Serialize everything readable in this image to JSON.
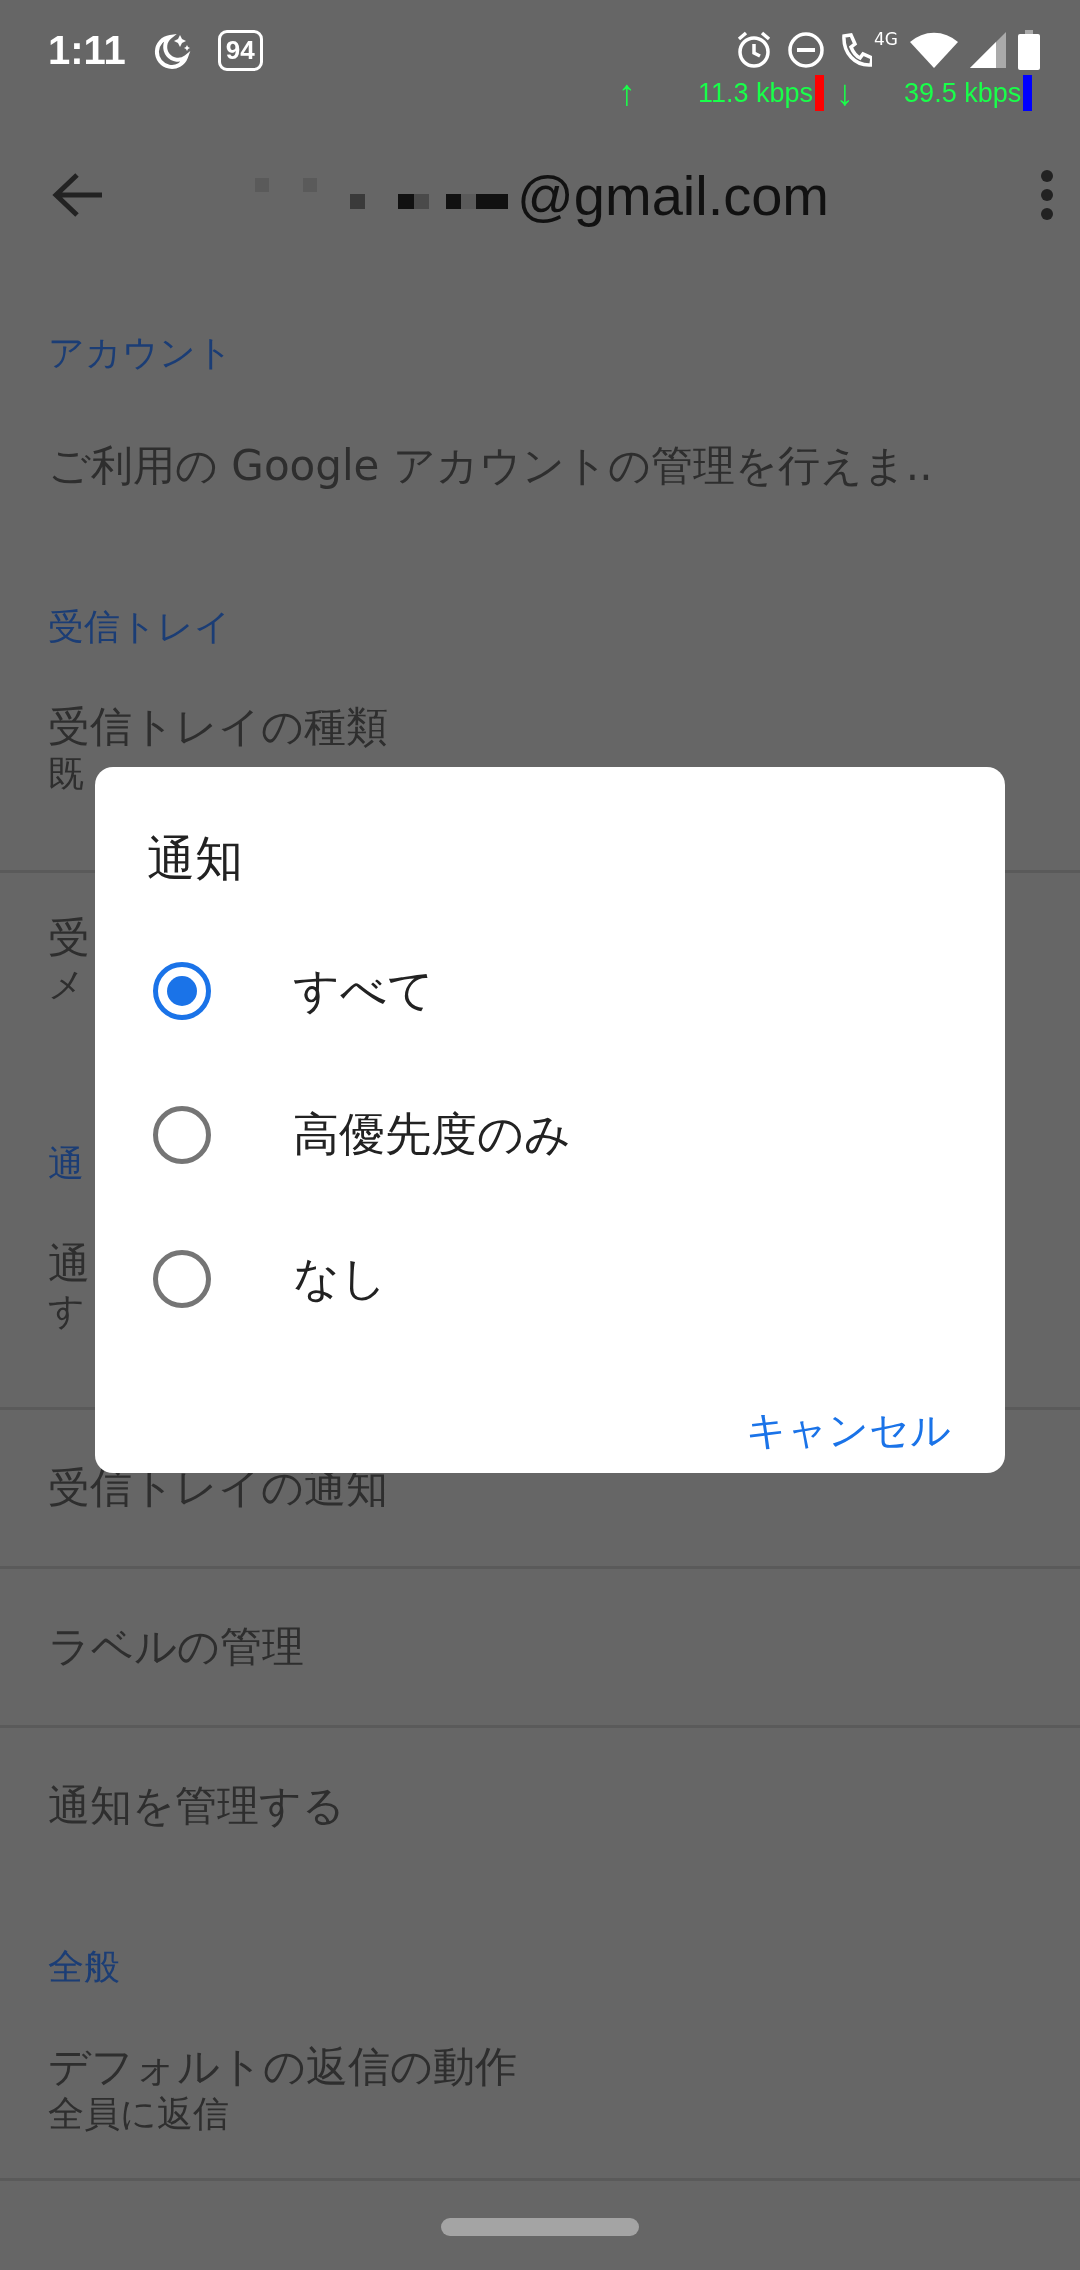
{
  "status_bar": {
    "time": "1:11",
    "battery_badge": "94",
    "network_type": "4G",
    "upload_arrow": "↑",
    "upload_speed": "11.3 kbps",
    "download_arrow": "↓",
    "download_speed": "39.5 kbps"
  },
  "app_bar": {
    "account": "@gmail.com"
  },
  "settings": [
    {
      "kind": "section",
      "label": "アカウント"
    },
    {
      "kind": "item",
      "title": "ご利用の Google アカウントの管理を行えま.."
    },
    {
      "kind": "section",
      "label": "受信トレイ"
    },
    {
      "kind": "item",
      "title": "受信トレイの種類",
      "subtitle": "既"
    },
    {
      "kind": "divider"
    },
    {
      "kind": "item",
      "title": "受",
      "subtitle": "メ"
    },
    {
      "kind": "section",
      "label": "通"
    },
    {
      "kind": "item",
      "title": "通",
      "subtitle": "す"
    },
    {
      "kind": "divider"
    },
    {
      "kind": "item",
      "title": "受信トレイの通知"
    },
    {
      "kind": "divider"
    },
    {
      "kind": "item",
      "title": "ラベルの管理"
    },
    {
      "kind": "divider"
    },
    {
      "kind": "item",
      "title": "通知を管理する"
    },
    {
      "kind": "section",
      "label": "全般"
    },
    {
      "kind": "item",
      "title": "デフォルトの返信の動作",
      "subtitle": "全員に返信"
    }
  ],
  "dialog": {
    "title": "通知",
    "options": [
      {
        "label": "すべて",
        "selected": true
      },
      {
        "label": "高優先度のみ",
        "selected": false
      },
      {
        "label": "なし",
        "selected": false
      }
    ],
    "buttons": [
      "キャンセル"
    ]
  }
}
